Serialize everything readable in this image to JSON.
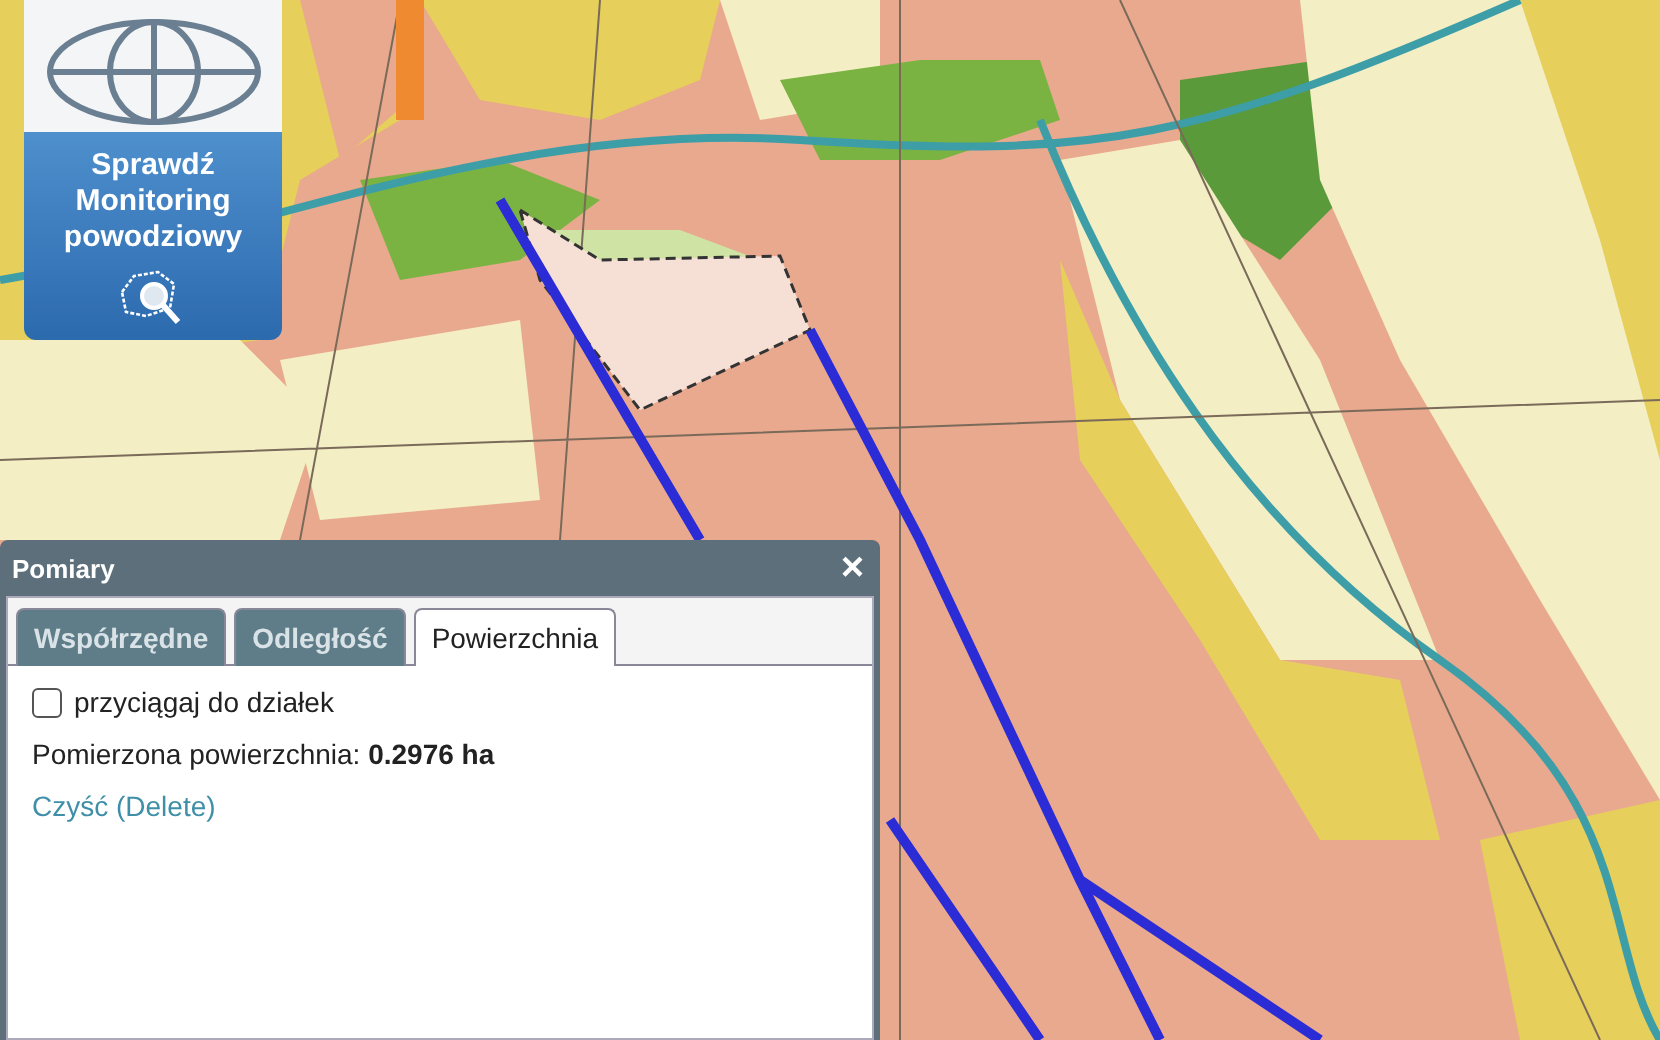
{
  "flood_button": {
    "label": "Sprawdź Monitoring powodziowy"
  },
  "dialog": {
    "title": "Pomiary",
    "close": "×",
    "tabs": [
      {
        "label": "Współrzędne",
        "selected": false
      },
      {
        "label": "Odległość",
        "selected": false
      },
      {
        "label": "Powierzchnia",
        "selected": true
      }
    ],
    "snap_option": {
      "label": "przyciągaj do działek",
      "checked": false
    },
    "measured": {
      "label": "Pomierzona powierzchnia:",
      "value": "0.2976 ha"
    },
    "clear_link": "Czyść (Delete)"
  }
}
